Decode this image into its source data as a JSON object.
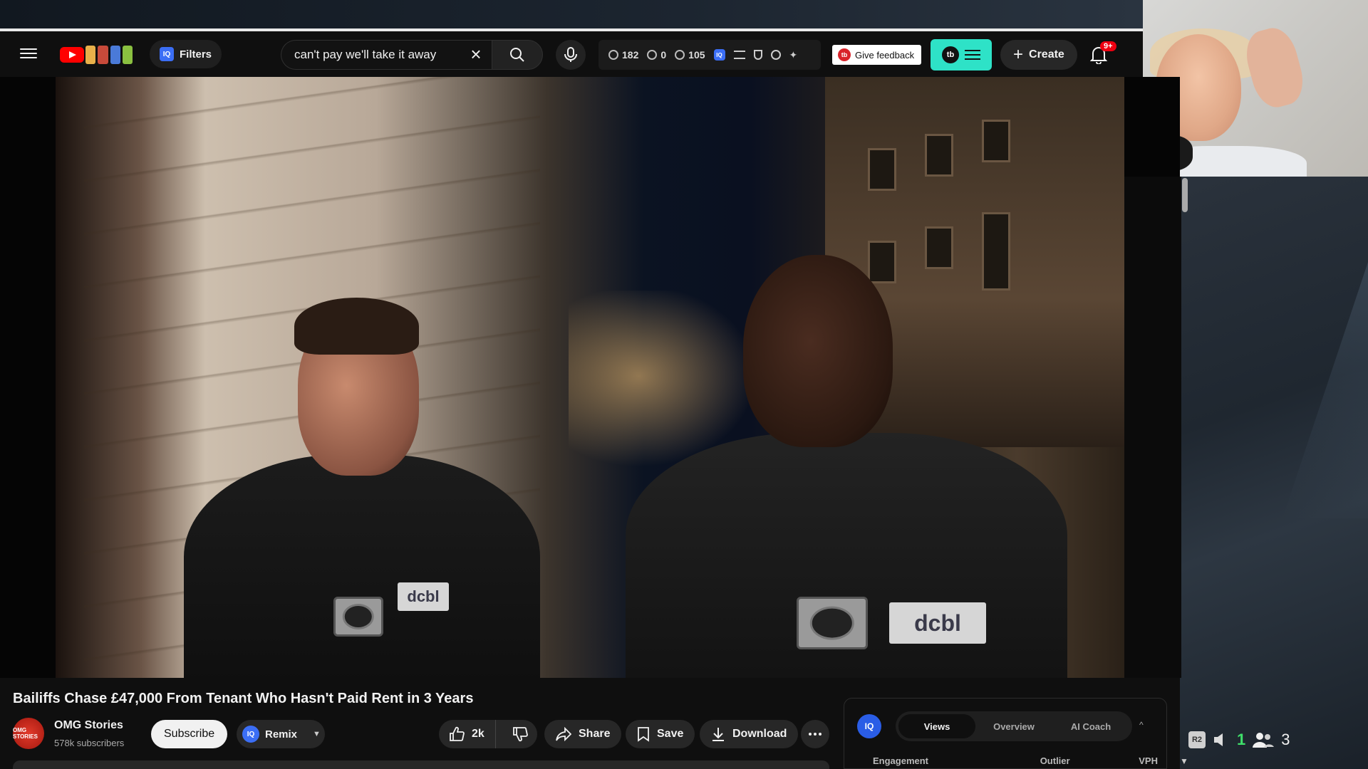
{
  "header": {
    "filters_label": "Filters",
    "search_value": "can't pay we'll take it away",
    "stats": {
      "views_clock": "182",
      "eye_zero": "0",
      "eye_count": "105"
    },
    "feedback_label": "Give feedback",
    "create_label": "Create",
    "notification_badge": "9+"
  },
  "video": {
    "title": "Bailiffs Chase £47,000 From Tenant Who Hasn't Paid Rent in 3 Years",
    "badge_left": "dcbl",
    "badge_right": "dcbl"
  },
  "channel": {
    "avatar_text": "OMG STORIES",
    "name": "OMG Stories",
    "subscribers": "578k subscribers",
    "subscribe_label": "Subscribe"
  },
  "actions": {
    "remix_label": "Remix",
    "like_count": "2k",
    "share_label": "Share",
    "save_label": "Save",
    "download_label": "Download"
  },
  "iq_panel": {
    "logo": "IQ",
    "tabs": [
      "Views",
      "Overview",
      "AI Coach"
    ],
    "active_tab": "Views",
    "columns": [
      "Engagement",
      "Outlier",
      "VPH"
    ]
  },
  "overlay": {
    "r2_label": "R2",
    "count_green": "1",
    "viewers": "3"
  },
  "colors": {
    "youtube_red": "#ff0000",
    "tubebuddy_teal": "#2ee2c7",
    "iq_blue": "#3b6ef5"
  }
}
